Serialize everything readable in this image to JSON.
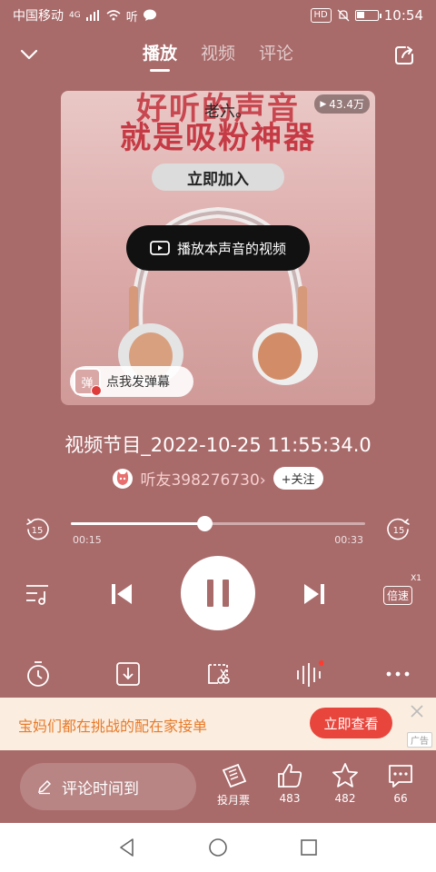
{
  "status_bar": {
    "carrier": "中国移动",
    "network": "4G",
    "extra_icons": "",
    "hd": "HD",
    "time": "10:54"
  },
  "header": {
    "tabs": [
      {
        "label": "播放",
        "active": true
      },
      {
        "label": "视频",
        "active": false
      },
      {
        "label": "评论",
        "active": false
      }
    ]
  },
  "cover": {
    "promo_line1": "好听的声音",
    "promo_line2": "就是吸粉神器",
    "overlay_user": "老六。",
    "join_button": "立即加入",
    "play_count": "43.4万",
    "video_pill_label": "播放本声音的视频",
    "danmu_icon": "弹",
    "danmu_label": "点我发弹幕"
  },
  "track": {
    "title": "视频节目_2022-10-25 11:55:34.0",
    "author": "听友398276730",
    "author_chevron": "›",
    "follow_label": "+关注"
  },
  "player": {
    "current_time": "00:15",
    "total_time": "00:33",
    "progress": 0.455,
    "skip_back_seconds": "15",
    "skip_forward_seconds": "15",
    "speed_label": "倍速",
    "speed_value": "X1"
  },
  "ad": {
    "text": "宝妈们都在挑战的配在家接单",
    "button_label": "立即查看",
    "tag": "广告"
  },
  "bottom": {
    "comment_placeholder": "评论时间到",
    "monthly_ticket_label": "投月票",
    "likes": "483",
    "favorites": "482",
    "comments": "66"
  },
  "colors": {
    "background": "#a96a6a",
    "ad_button": "#e8463d",
    "ad_text": "#e77a2a",
    "ad_background": "#fbeee0"
  }
}
